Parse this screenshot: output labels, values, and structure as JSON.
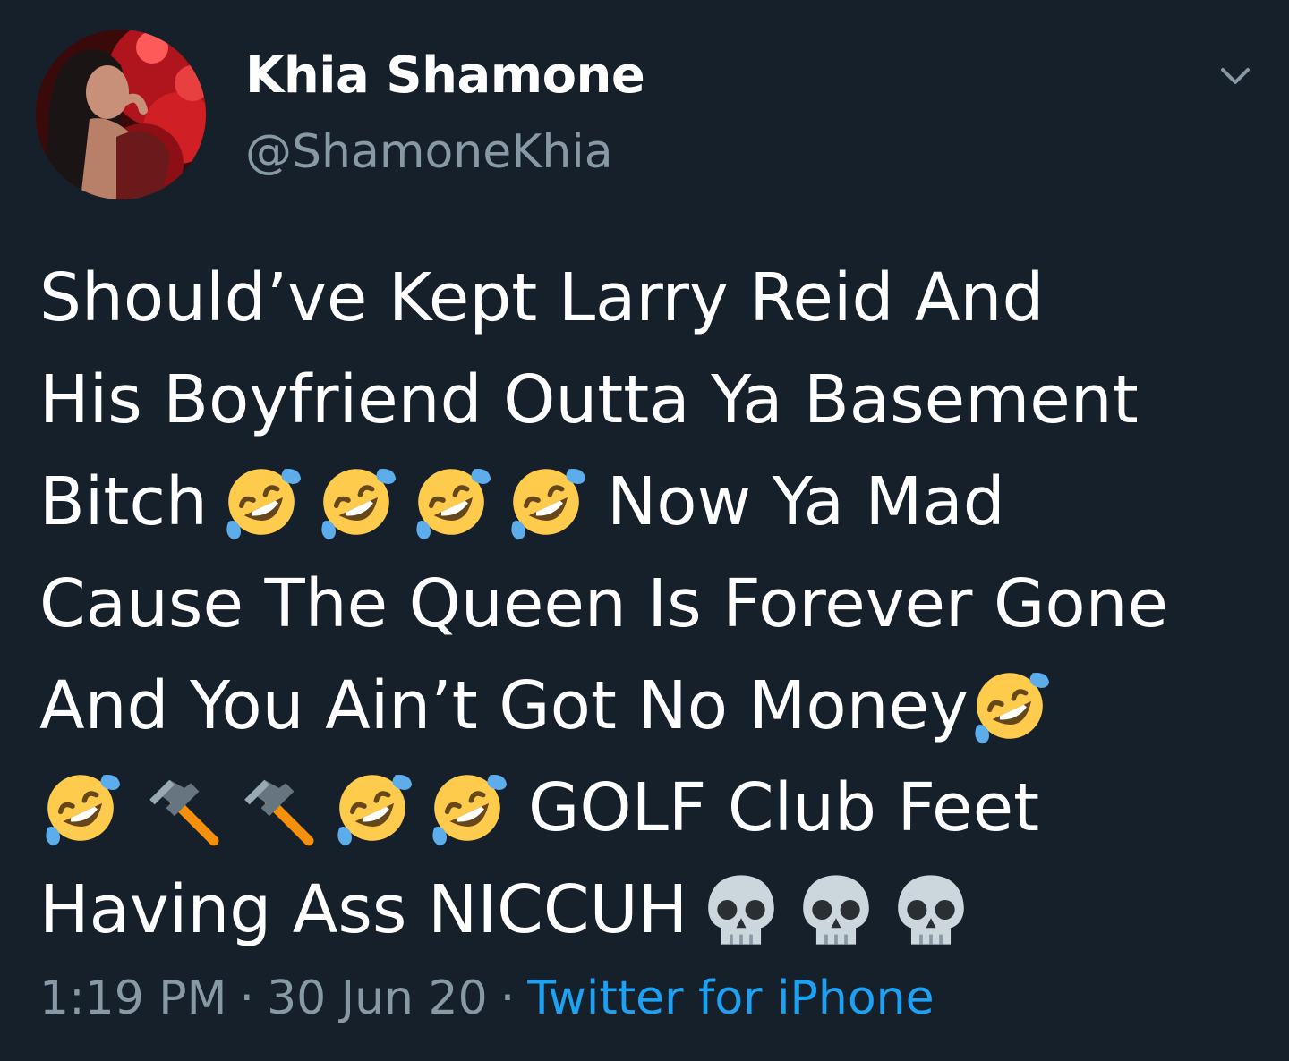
{
  "user": {
    "display_name": "Khia Shamone",
    "handle": "@ShamoneKhia"
  },
  "tweet": {
    "line1": "Should’ve Kept Larry Reid And",
    "line2": "His Boyfriend Outta Ya Basement",
    "line3_text": "Bitch",
    "line3_tail": "Now Ya Mad",
    "line4": "Cause The Queen Is Forever Gone",
    "line5": "And You Ain’t Got No Money",
    "line6_tail": "GOLF Club Feet",
    "line7": "Having Ass NICCUH",
    "emojis": [
      "rolling-on-floor-laughing-emoji",
      "hammer-emoji",
      "skull-emoji"
    ]
  },
  "meta": {
    "time": "1:19 PM",
    "separator": "·",
    "date": "30 Jun 20",
    "source": "Twitter for iPhone"
  },
  "colors": {
    "background": "#15202b",
    "text": "#ffffff",
    "secondary_text": "#8899a6",
    "link": "#1da1f2"
  }
}
